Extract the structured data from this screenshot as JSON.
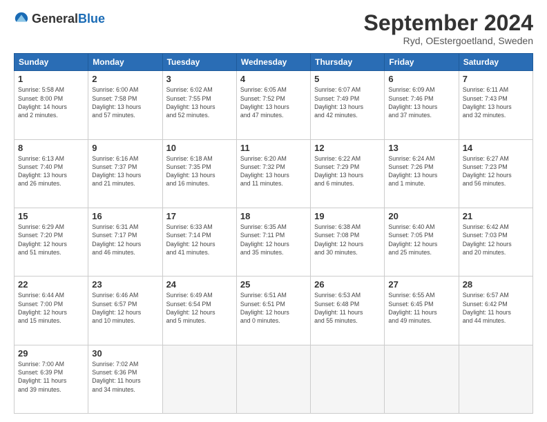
{
  "header": {
    "logo": {
      "general": "General",
      "blue": "Blue"
    },
    "title": "September 2024",
    "location": "Ryd, OEstergoetland, Sweden"
  },
  "weekdays": [
    "Sunday",
    "Monday",
    "Tuesday",
    "Wednesday",
    "Thursday",
    "Friday",
    "Saturday"
  ],
  "days": [
    {
      "num": "",
      "info": ""
    },
    {
      "num": "1",
      "info": "Sunrise: 5:58 AM\nSunset: 8:00 PM\nDaylight: 14 hours\nand 2 minutes."
    },
    {
      "num": "2",
      "info": "Sunrise: 6:00 AM\nSunset: 7:58 PM\nDaylight: 13 hours\nand 57 minutes."
    },
    {
      "num": "3",
      "info": "Sunrise: 6:02 AM\nSunset: 7:55 PM\nDaylight: 13 hours\nand 52 minutes."
    },
    {
      "num": "4",
      "info": "Sunrise: 6:05 AM\nSunset: 7:52 PM\nDaylight: 13 hours\nand 47 minutes."
    },
    {
      "num": "5",
      "info": "Sunrise: 6:07 AM\nSunset: 7:49 PM\nDaylight: 13 hours\nand 42 minutes."
    },
    {
      "num": "6",
      "info": "Sunrise: 6:09 AM\nSunset: 7:46 PM\nDaylight: 13 hours\nand 37 minutes."
    },
    {
      "num": "7",
      "info": "Sunrise: 6:11 AM\nSunset: 7:43 PM\nDaylight: 13 hours\nand 32 minutes."
    },
    {
      "num": "8",
      "info": "Sunrise: 6:13 AM\nSunset: 7:40 PM\nDaylight: 13 hours\nand 26 minutes."
    },
    {
      "num": "9",
      "info": "Sunrise: 6:16 AM\nSunset: 7:37 PM\nDaylight: 13 hours\nand 21 minutes."
    },
    {
      "num": "10",
      "info": "Sunrise: 6:18 AM\nSunset: 7:35 PM\nDaylight: 13 hours\nand 16 minutes."
    },
    {
      "num": "11",
      "info": "Sunrise: 6:20 AM\nSunset: 7:32 PM\nDaylight: 13 hours\nand 11 minutes."
    },
    {
      "num": "12",
      "info": "Sunrise: 6:22 AM\nSunset: 7:29 PM\nDaylight: 13 hours\nand 6 minutes."
    },
    {
      "num": "13",
      "info": "Sunrise: 6:24 AM\nSunset: 7:26 PM\nDaylight: 13 hours\nand 1 minute."
    },
    {
      "num": "14",
      "info": "Sunrise: 6:27 AM\nSunset: 7:23 PM\nDaylight: 12 hours\nand 56 minutes."
    },
    {
      "num": "15",
      "info": "Sunrise: 6:29 AM\nSunset: 7:20 PM\nDaylight: 12 hours\nand 51 minutes."
    },
    {
      "num": "16",
      "info": "Sunrise: 6:31 AM\nSunset: 7:17 PM\nDaylight: 12 hours\nand 46 minutes."
    },
    {
      "num": "17",
      "info": "Sunrise: 6:33 AM\nSunset: 7:14 PM\nDaylight: 12 hours\nand 41 minutes."
    },
    {
      "num": "18",
      "info": "Sunrise: 6:35 AM\nSunset: 7:11 PM\nDaylight: 12 hours\nand 35 minutes."
    },
    {
      "num": "19",
      "info": "Sunrise: 6:38 AM\nSunset: 7:08 PM\nDaylight: 12 hours\nand 30 minutes."
    },
    {
      "num": "20",
      "info": "Sunrise: 6:40 AM\nSunset: 7:05 PM\nDaylight: 12 hours\nand 25 minutes."
    },
    {
      "num": "21",
      "info": "Sunrise: 6:42 AM\nSunset: 7:03 PM\nDaylight: 12 hours\nand 20 minutes."
    },
    {
      "num": "22",
      "info": "Sunrise: 6:44 AM\nSunset: 7:00 PM\nDaylight: 12 hours\nand 15 minutes."
    },
    {
      "num": "23",
      "info": "Sunrise: 6:46 AM\nSunset: 6:57 PM\nDaylight: 12 hours\nand 10 minutes."
    },
    {
      "num": "24",
      "info": "Sunrise: 6:49 AM\nSunset: 6:54 PM\nDaylight: 12 hours\nand 5 minutes."
    },
    {
      "num": "25",
      "info": "Sunrise: 6:51 AM\nSunset: 6:51 PM\nDaylight: 12 hours\nand 0 minutes."
    },
    {
      "num": "26",
      "info": "Sunrise: 6:53 AM\nSunset: 6:48 PM\nDaylight: 11 hours\nand 55 minutes."
    },
    {
      "num": "27",
      "info": "Sunrise: 6:55 AM\nSunset: 6:45 PM\nDaylight: 11 hours\nand 49 minutes."
    },
    {
      "num": "28",
      "info": "Sunrise: 6:57 AM\nSunset: 6:42 PM\nDaylight: 11 hours\nand 44 minutes."
    },
    {
      "num": "29",
      "info": "Sunrise: 7:00 AM\nSunset: 6:39 PM\nDaylight: 11 hours\nand 39 minutes."
    },
    {
      "num": "30",
      "info": "Sunrise: 7:02 AM\nSunset: 6:36 PM\nDaylight: 11 hours\nand 34 minutes."
    },
    {
      "num": "",
      "info": ""
    },
    {
      "num": "",
      "info": ""
    },
    {
      "num": "",
      "info": ""
    },
    {
      "num": "",
      "info": ""
    },
    {
      "num": "",
      "info": ""
    }
  ]
}
